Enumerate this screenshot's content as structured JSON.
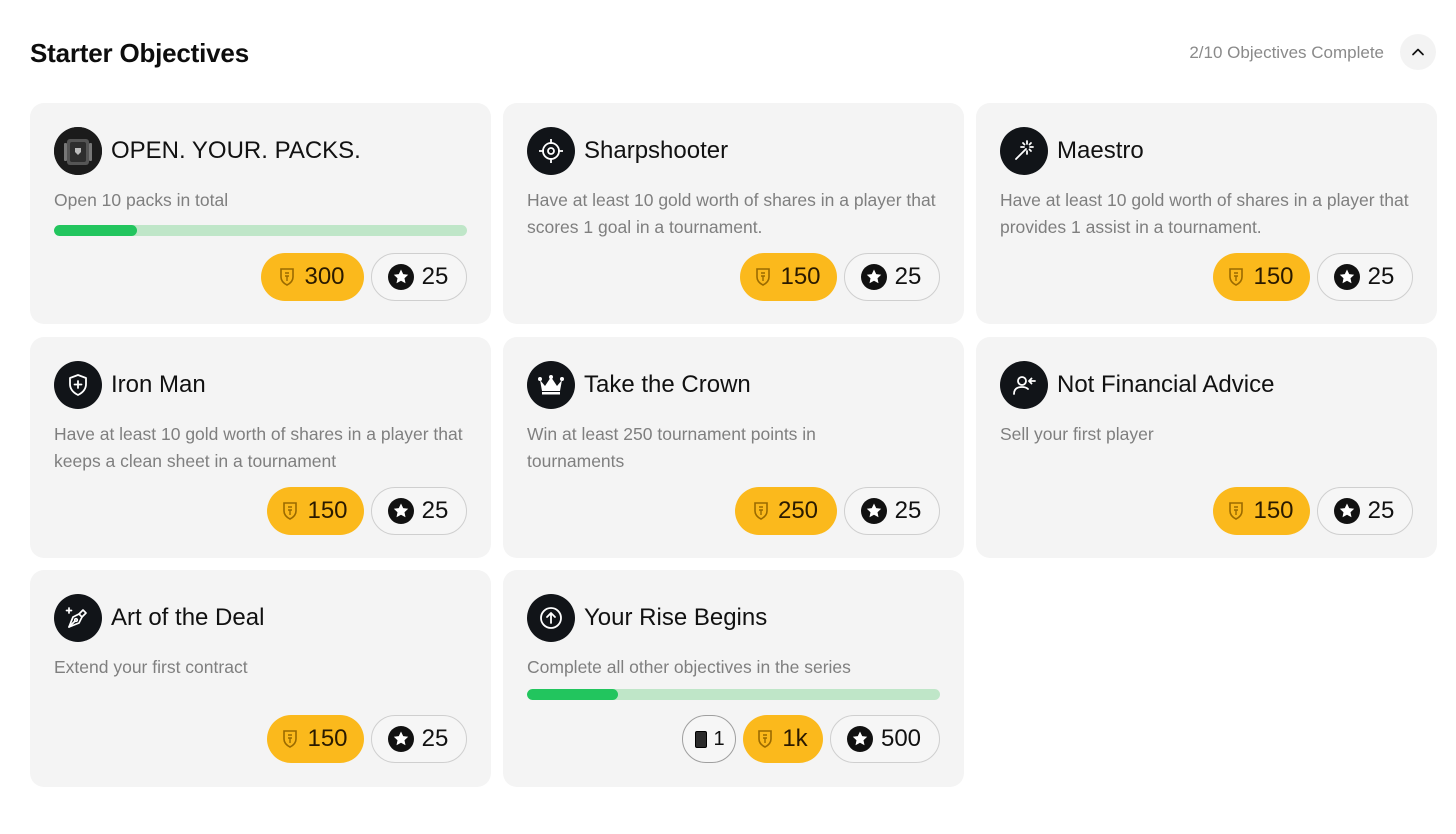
{
  "header": {
    "title": "Starter Objectives",
    "progress": "2/10 Objectives Complete"
  },
  "colors": {
    "coin": "#fbb91c",
    "bar_track": "#bfe6c8",
    "bar_fill": "#22c55e",
    "card_bg": "#f4f4f4",
    "icon_bg": "#111418"
  },
  "objectives": [
    {
      "icon": "pack-icon",
      "title": "OPEN. YOUR. PACKS.",
      "description": "Open 10 packs in total",
      "progress": 0.2,
      "coins": "300",
      "stars": "25"
    },
    {
      "icon": "crosshair-icon",
      "title": "Sharpshooter",
      "description": "Have at least 10 gold worth of shares in a player that scores 1 goal in a tournament.",
      "coins": "150",
      "stars": "25"
    },
    {
      "icon": "magic-wand-icon",
      "title": "Maestro",
      "description": "Have at least 10 gold worth of shares in a player that provides 1 assist in a tournament.",
      "coins": "150",
      "stars": "25"
    },
    {
      "icon": "shield-plus-icon",
      "title": "Iron Man",
      "description": "Have at least 10 gold worth of shares in a player that keeps a clean sheet in a tournament",
      "coins": "150",
      "stars": "25"
    },
    {
      "icon": "crown-icon",
      "title": "Take the Crown",
      "description": "Win at least 250 tournament points in tournaments",
      "coins": "250",
      "stars": "25"
    },
    {
      "icon": "user-arrow-icon",
      "title": "Not Financial Advice",
      "description": "Sell your first player",
      "coins": "150",
      "stars": "25"
    },
    {
      "icon": "pen-nib-icon",
      "title": "Art of the Deal",
      "description": "Extend your first contract",
      "coins": "150",
      "stars": "25"
    },
    {
      "icon": "arrow-up-circle-icon",
      "title": "Your Rise Begins",
      "description": "Complete all other objectives in the series",
      "progress": 0.22,
      "packs": "1",
      "coins": "1k",
      "stars": "500"
    }
  ]
}
